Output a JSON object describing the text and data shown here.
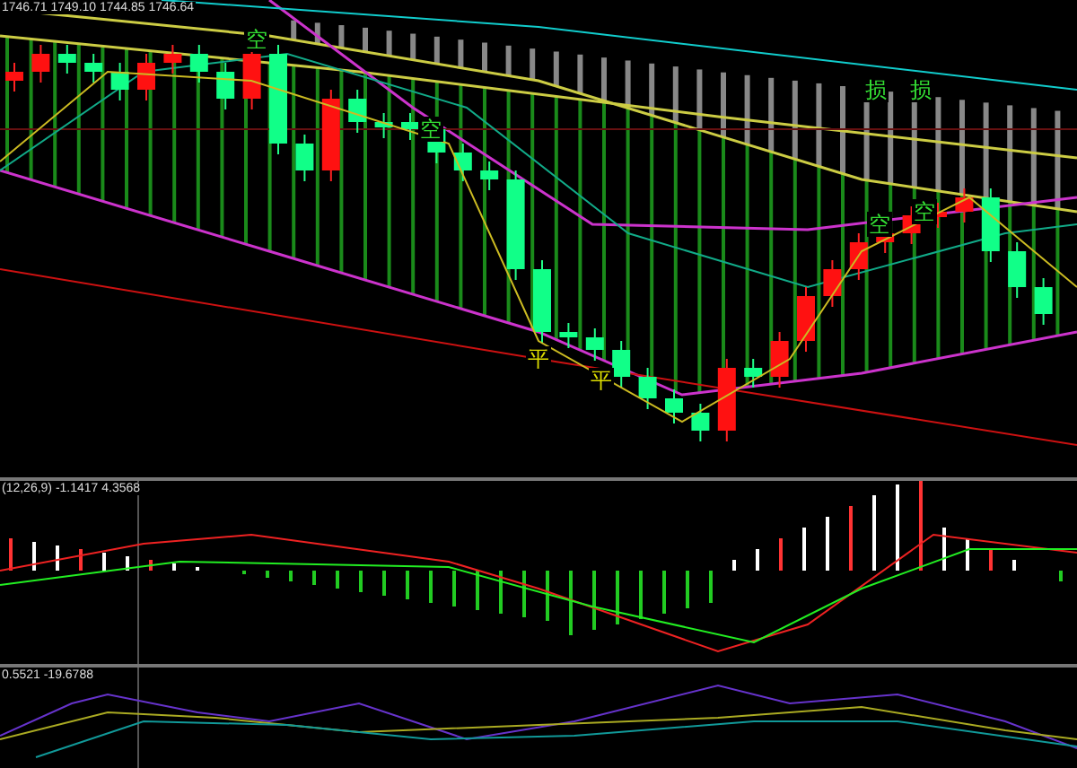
{
  "main_panel": {
    "ohlc_readout": "1746.71 1749.10 1744.85 1746.64",
    "signals": [
      {
        "label": "空",
        "color": "#33dd33"
      },
      {
        "label": "损",
        "color": "#33dd33"
      },
      {
        "label": "损",
        "color": "#33dd33"
      },
      {
        "label": "空",
        "color": "#33dd33"
      },
      {
        "label": "空",
        "color": "#33dd33"
      },
      {
        "label": "空",
        "color": "#33dd33"
      },
      {
        "label": "平",
        "color": "#dddd00"
      },
      {
        "label": "平",
        "color": "#dddd00"
      }
    ]
  },
  "macd_panel": {
    "readout": "(12,26,9) -1.1417 4.3568"
  },
  "oscillator_panel": {
    "readout": "0.5521 -19.6788"
  }
}
